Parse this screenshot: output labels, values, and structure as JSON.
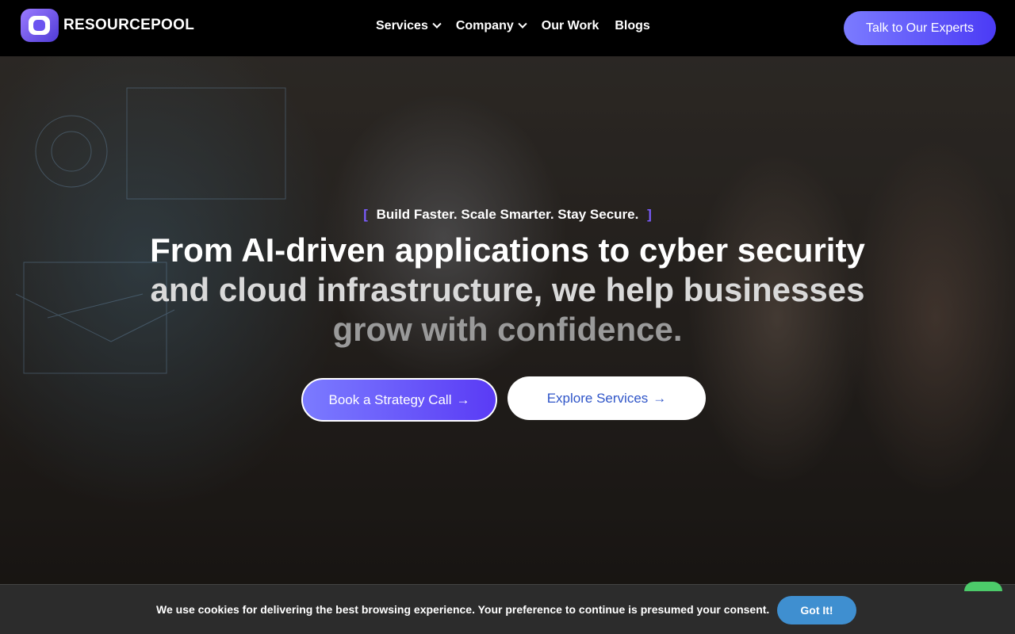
{
  "header": {
    "logo_text": "RESOURCEPOOL",
    "nav": [
      {
        "label": "Services",
        "has_dropdown": true
      },
      {
        "label": "Company",
        "has_dropdown": true
      },
      {
        "label": "Our Work",
        "has_dropdown": false
      },
      {
        "label": "Blogs",
        "has_dropdown": false
      }
    ],
    "cta_label": "Talk to Our Experts"
  },
  "hero": {
    "tagline": "Build Faster. Scale Smarter. Stay Secure.",
    "bracket_open": "[",
    "bracket_close": "]",
    "headline_lines": [
      "From AI-driven applications to cyber security",
      "and cloud infrastructure, we help businesses",
      "grow with confidence."
    ],
    "primary_button": "Book a Strategy Call",
    "secondary_button": "Explore Services",
    "arrow": "→"
  },
  "cookie_bar": {
    "text": "We use cookies for delivering the best browsing experience. Your preference to continue is presumed your consent.",
    "button": "Got It!"
  },
  "colors": {
    "accent_gradient_start": "#7b7bff",
    "accent_gradient_end": "#4b3bf5",
    "bracket": "#7b5cff",
    "cookie_button": "#3f8fd0",
    "secondary_button_text": "#2f55c8"
  }
}
